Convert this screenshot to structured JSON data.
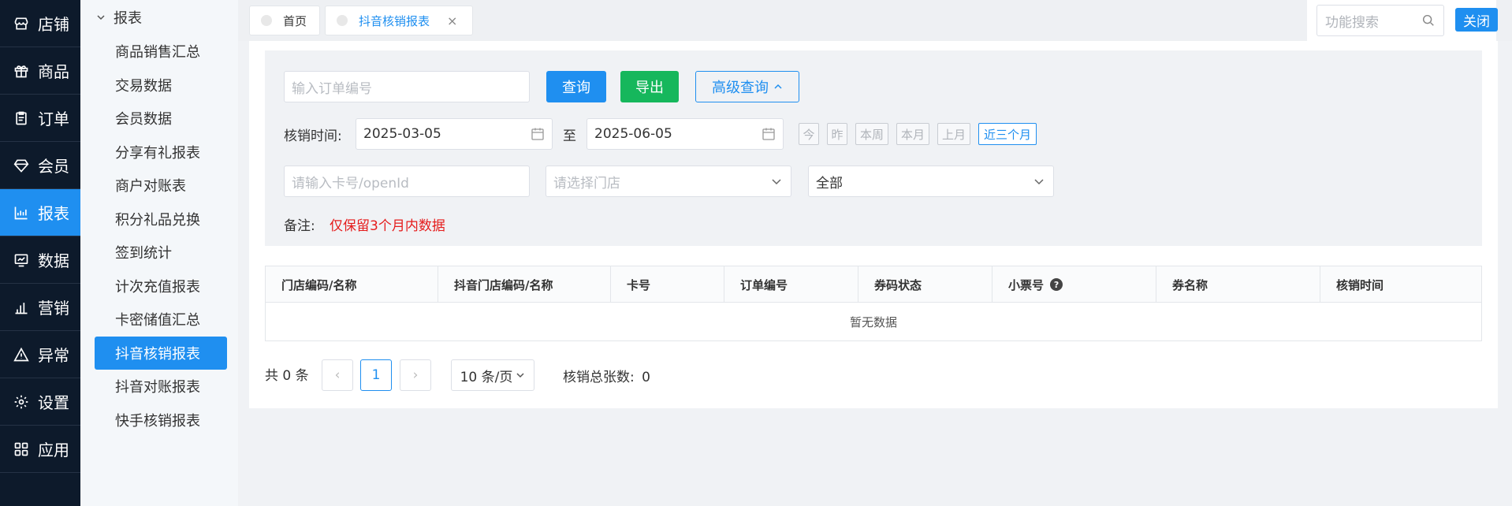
{
  "nav": {
    "items": [
      {
        "label": "店铺",
        "icon": "store-icon"
      },
      {
        "label": "商品",
        "icon": "gift-icon"
      },
      {
        "label": "订单",
        "icon": "clipboard-icon"
      },
      {
        "label": "会员",
        "icon": "diamond-icon"
      },
      {
        "label": "报表",
        "icon": "bar-chart-icon"
      },
      {
        "label": "数据",
        "icon": "monitor-chart-icon"
      },
      {
        "label": "营销",
        "icon": "column-chart-icon"
      },
      {
        "label": "异常",
        "icon": "warning-icon"
      },
      {
        "label": "设置",
        "icon": "gear-icon"
      },
      {
        "label": "应用",
        "icon": "grid-icon"
      }
    ],
    "active_index": 4
  },
  "subnav": {
    "header": "报表",
    "items": [
      "商品销售汇总",
      "交易数据",
      "会员数据",
      "分享有礼报表",
      "商户对账表",
      "积分礼品兑换",
      "签到统计",
      "计次充值报表",
      "卡密储值汇总",
      "抖音核销报表",
      "抖音对账报表",
      "快手核销报表"
    ],
    "active_index": 9
  },
  "tabs": {
    "home": "首页",
    "current": "抖音核销报表",
    "close_glyph": "×"
  },
  "topbar": {
    "search_placeholder": "功能搜索",
    "close_label": "关闭"
  },
  "filters": {
    "order_no_placeholder": "输入订单编号",
    "query_label": "查询",
    "export_label": "导出",
    "advanced_label": "高级查询",
    "time_label": "核销时间:",
    "date_start": "2025-03-05",
    "range_sep": "至",
    "date_end": "2025-06-05",
    "quick": [
      "今",
      "昨",
      "本周",
      "本月",
      "上月",
      "近三个月"
    ],
    "quick_active_index": 5,
    "card_placeholder": "请输入卡号/openId",
    "store_placeholder": "请选择门店",
    "status_value": "全部",
    "note_label": "备注:",
    "note_text": "仅保留3个月内数据"
  },
  "table": {
    "columns": [
      "门店编码/名称",
      "抖音门店编码/名称",
      "卡号",
      "订单编号",
      "券码状态",
      "小票号",
      "券名称",
      "核销时间"
    ],
    "help_glyph": "?",
    "empty_text": "暂无数据"
  },
  "pagination": {
    "total_text": "共 0 条",
    "current_page": "1",
    "prev_glyph": "‹",
    "next_glyph": "›",
    "page_size": "10 条/页",
    "summary_label": "核销总张数:",
    "summary_value": "0"
  },
  "colors": {
    "nav_bg": "#0d1a2b",
    "accent": "#1f8ff0",
    "success": "#16b75c",
    "danger": "#e51c1c"
  }
}
